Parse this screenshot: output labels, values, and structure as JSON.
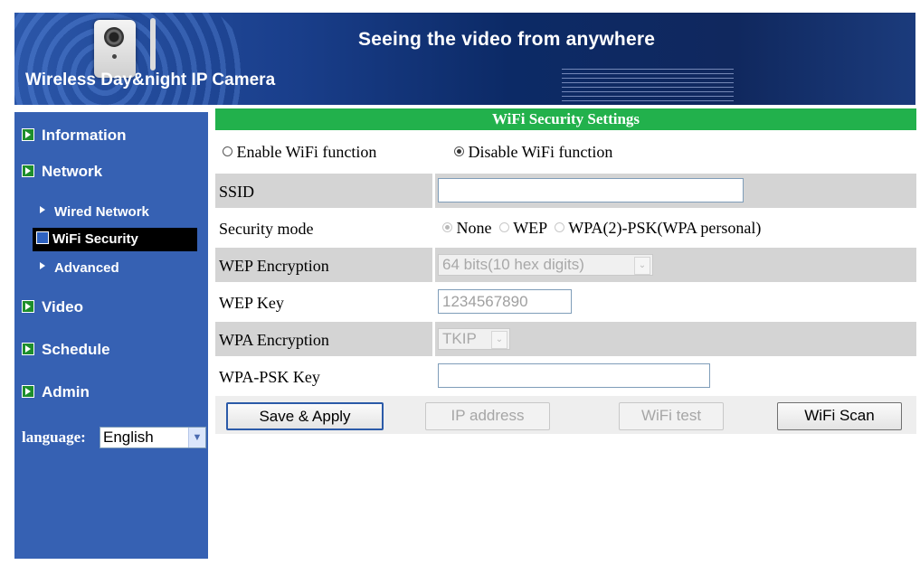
{
  "banner": {
    "main_title": "Seeing the video from anywhere",
    "product_name": "Wireless Day&night IP Camera"
  },
  "sidebar": {
    "items": [
      {
        "label": "Information"
      },
      {
        "label": "Network"
      },
      {
        "label": "Video"
      },
      {
        "label": "Schedule"
      },
      {
        "label": "Admin"
      }
    ],
    "network_subitems": [
      {
        "label": "Wired Network"
      },
      {
        "label": "WiFi Security",
        "selected": true
      },
      {
        "label": "Advanced"
      }
    ],
    "language_label": "language:",
    "language_value": "English"
  },
  "main": {
    "section_title": "WiFi Security Settings",
    "wifi_function": {
      "enable_label": "Enable WiFi function",
      "disable_label": "Disable WiFi function",
      "selected": "disable"
    },
    "fields": {
      "ssid_label": "SSID",
      "ssid_value": "",
      "security_mode_label": "Security mode",
      "security_mode_options": [
        "None",
        "WEP",
        "WPA(2)-PSK(WPA personal)"
      ],
      "security_mode_selected": "None",
      "wep_encryption_label": "WEP Encryption",
      "wep_encryption_value": "64 bits(10 hex digits)",
      "wep_key_label": "WEP Key",
      "wep_key_value": "1234567890",
      "wpa_encryption_label": "WPA Encryption",
      "wpa_encryption_value": "TKIP",
      "wpa_psk_key_label": "WPA-PSK Key",
      "wpa_psk_key_value": ""
    },
    "buttons": {
      "save_apply": "Save & Apply",
      "ip_address": "IP address",
      "wifi_test": "WiFi test",
      "wifi_scan": "WiFi Scan"
    }
  },
  "colors": {
    "header_green": "#22b14c",
    "sidebar_blue": "#3661b3",
    "row_gray": "#d4d4d4"
  }
}
